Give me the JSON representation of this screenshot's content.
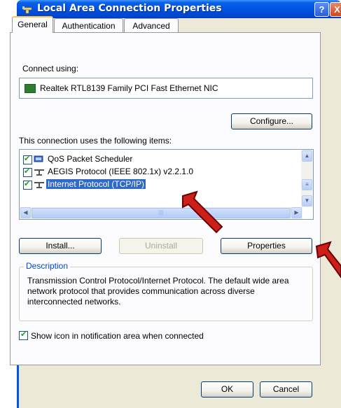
{
  "window": {
    "title": "Local Area Connection Properties",
    "help_label": "?",
    "close_label": "X"
  },
  "tabs": [
    {
      "label": "General",
      "selected": true
    },
    {
      "label": "Authentication",
      "selected": false
    },
    {
      "label": "Advanced",
      "selected": false
    }
  ],
  "general": {
    "connect_using_label": "Connect using:",
    "adapter_name": "Realtek RTL8139 Family PCI Fast Ethernet NIC",
    "configure_label": "Configure...",
    "items_label": "This connection uses the following items:",
    "items": [
      {
        "label": "QoS Packet Scheduler",
        "checked": true,
        "icon": "scheduler-icon"
      },
      {
        "label": "AEGIS Protocol (IEEE 802.1x) v2.2.1.0",
        "checked": true,
        "icon": "protocol-icon"
      },
      {
        "label": "Internet Protocol (TCP/IP)",
        "checked": true,
        "icon": "protocol-icon",
        "selected": true
      }
    ],
    "install_label": "Install...",
    "uninstall_label": "Uninstall",
    "properties_label": "Properties",
    "description_legend": "Description",
    "description_text": "Transmission Control Protocol/Internet Protocol. The default wide area network protocol that provides communication across diverse interconnected networks.",
    "show_icon_label": "Show icon in notification area when connected",
    "show_icon_checked": true
  },
  "footer": {
    "ok_label": "OK",
    "cancel_label": "Cancel"
  },
  "colors": {
    "title_bar": "#0054e3",
    "selection": "#316ac5",
    "annotation_arrow": "#cc1f1a"
  }
}
